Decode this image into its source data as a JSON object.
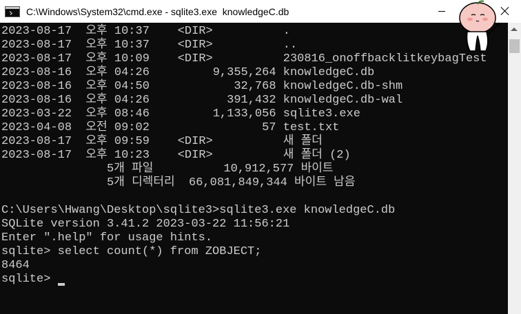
{
  "window": {
    "title": "C:\\Windows\\System32\\cmd.exe - sqlite3.exe  knowledgeC.db"
  },
  "console": {
    "lines": [
      "2023-08-17  오후 10:37    <DIR>          .",
      "2023-08-17  오후 10:37    <DIR>          ..",
      "2023-08-17  오후 10:09    <DIR>          230816_onoffbacklitkeybagTest",
      "2023-08-16  오후 04:26         9,355,264 knowledgeC.db",
      "2023-08-16  오후 04:50            32,768 knowledgeC.db-shm",
      "2023-08-16  오후 04:26           391,432 knowledgeC.db-wal",
      "2023-03-22  오후 08:46         1,133,056 sqlite3.exe",
      "2023-04-08  오전 09:02                57 test.txt",
      "2023-08-17  오후 09:59    <DIR>          새 폴더",
      "2023-08-17  오후 10:23    <DIR>          새 폴더 (2)",
      "               5개 파일          10,912,577 바이트",
      "               5개 디렉터리  66,081,849,344 바이트 남음",
      "",
      "C:\\Users\\Hwang\\Desktop\\sqlite3>sqlite3.exe knowledgeC.db",
      "SQLite version 3.41.2 2023-03-22 11:56:21",
      "Enter \".help\" for usage hints.",
      "sqlite> select count(*) from ZOBJECT;",
      "8464"
    ],
    "prompt": "sqlite> "
  }
}
